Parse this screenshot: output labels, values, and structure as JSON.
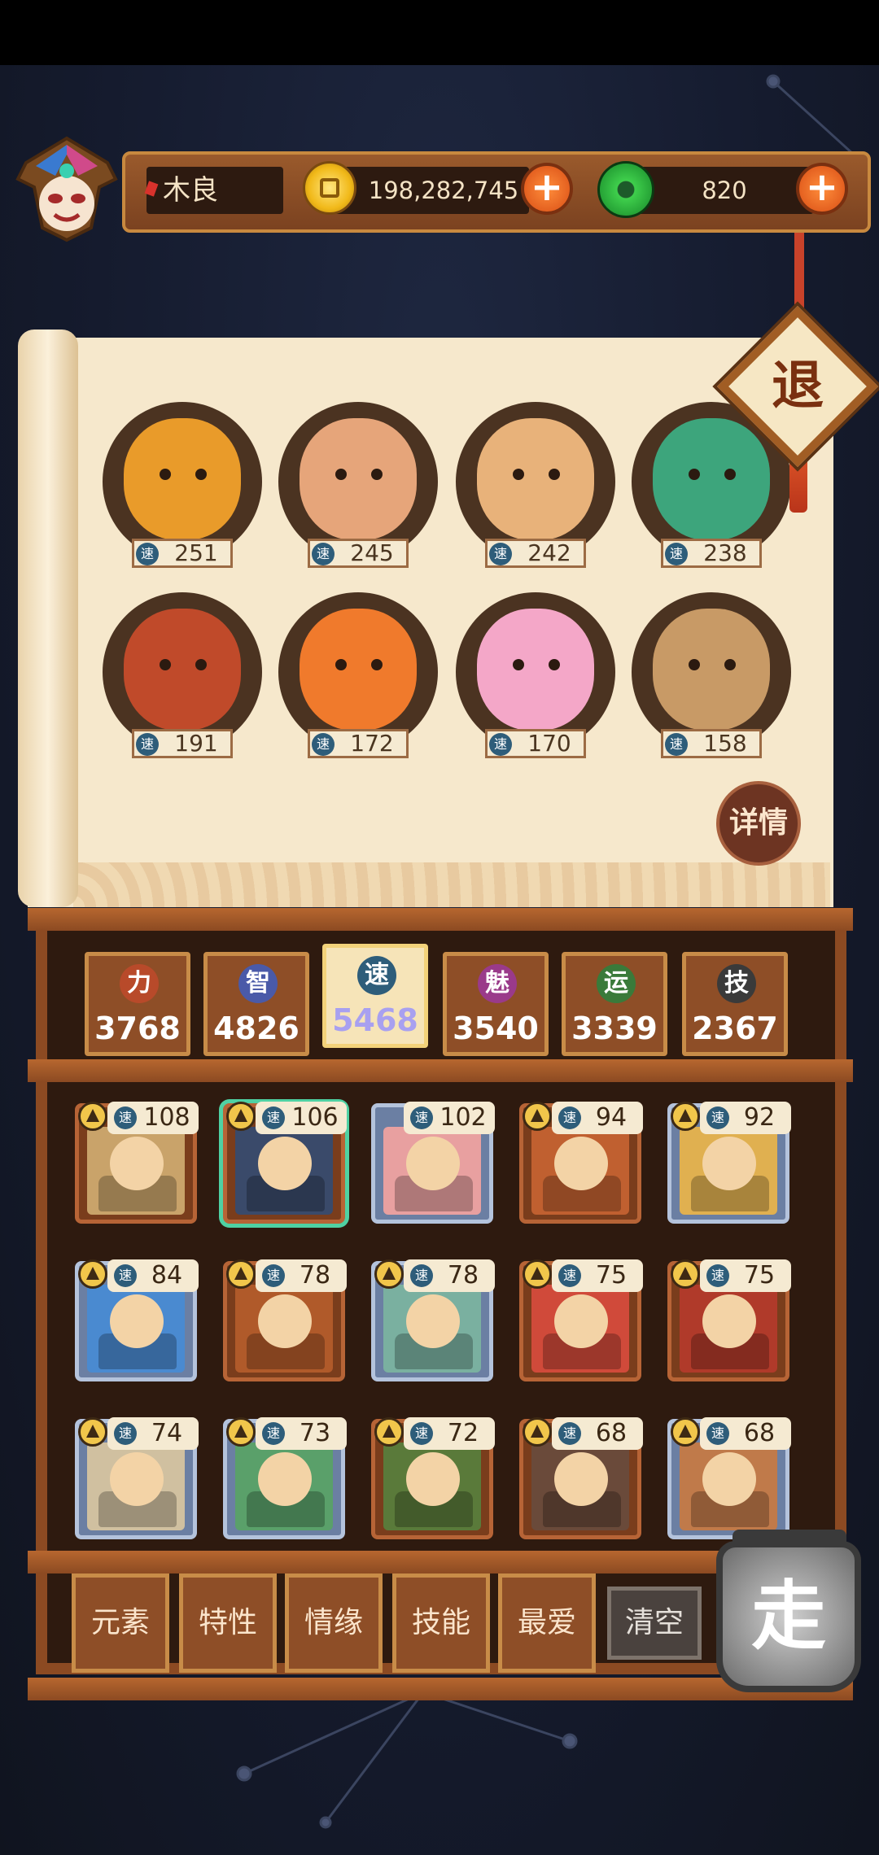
{
  "player": {
    "name": "木良",
    "gold": "198,282,745",
    "jade": "820"
  },
  "buttons": {
    "exit": "退",
    "detail": "详情",
    "go": "走",
    "plus": "+"
  },
  "speed_label": "速",
  "team": [
    {
      "speed": "251",
      "color": "#e99b2a"
    },
    {
      "speed": "245",
      "color": "#e6a57a"
    },
    {
      "speed": "242",
      "color": "#e8b27a"
    },
    {
      "speed": "238",
      "color": "#3da57c"
    },
    {
      "speed": "191",
      "color": "#c04a2a"
    },
    {
      "speed": "172",
      "color": "#f07a2c"
    },
    {
      "speed": "170",
      "color": "#f4a7c8"
    },
    {
      "speed": "158",
      "color": "#c89a66"
    }
  ],
  "stats": [
    {
      "icon": "力",
      "value": "3768",
      "color": "#b84a2a"
    },
    {
      "icon": "智",
      "value": "4826",
      "color": "#4a5aa8"
    },
    {
      "icon": "速",
      "value": "5468",
      "color": "#2e5d7a",
      "active": true
    },
    {
      "icon": "魅",
      "value": "3540",
      "color": "#9a3a8a"
    },
    {
      "icon": "运",
      "value": "3339",
      "color": "#3a7a3a"
    },
    {
      "icon": "技",
      "value": "2367",
      "color": "#3a3a3a"
    }
  ],
  "roster": [
    {
      "speed": "108",
      "frame": "bronze",
      "tri": true,
      "art": "#c9a36a"
    },
    {
      "speed": "106",
      "frame": "bronze",
      "tri": true,
      "art": "#3a4a6a",
      "selected": true
    },
    {
      "speed": "102",
      "frame": "silver",
      "tri": false,
      "art": "#e8a0a0"
    },
    {
      "speed": "94",
      "frame": "bronze",
      "tri": true,
      "art": "#c06030"
    },
    {
      "speed": "92",
      "frame": "silver",
      "tri": true,
      "art": "#e0b050"
    },
    {
      "speed": "84",
      "frame": "silver",
      "tri": true,
      "art": "#4a8ad0"
    },
    {
      "speed": "78",
      "frame": "bronze",
      "tri": true,
      "art": "#b05a2a"
    },
    {
      "speed": "78",
      "frame": "silver",
      "tri": true,
      "art": "#7ab0a0"
    },
    {
      "speed": "75",
      "frame": "bronze",
      "tri": true,
      "art": "#d04a3a"
    },
    {
      "speed": "75",
      "frame": "bronze",
      "tri": true,
      "art": "#b03a2a"
    },
    {
      "speed": "74",
      "frame": "silver",
      "tri": true,
      "art": "#d0c0a0"
    },
    {
      "speed": "73",
      "frame": "silver",
      "tri": true,
      "art": "#5aa06a"
    },
    {
      "speed": "72",
      "frame": "bronze",
      "tri": true,
      "art": "#5a7a3a"
    },
    {
      "speed": "68",
      "frame": "bronze",
      "tri": true,
      "art": "#6a4a3a"
    },
    {
      "speed": "68",
      "frame": "silver",
      "tri": true,
      "art": "#c07a4a"
    }
  ],
  "filters": [
    "元素",
    "特性",
    "情缘",
    "技能",
    "最爱",
    "清空"
  ]
}
